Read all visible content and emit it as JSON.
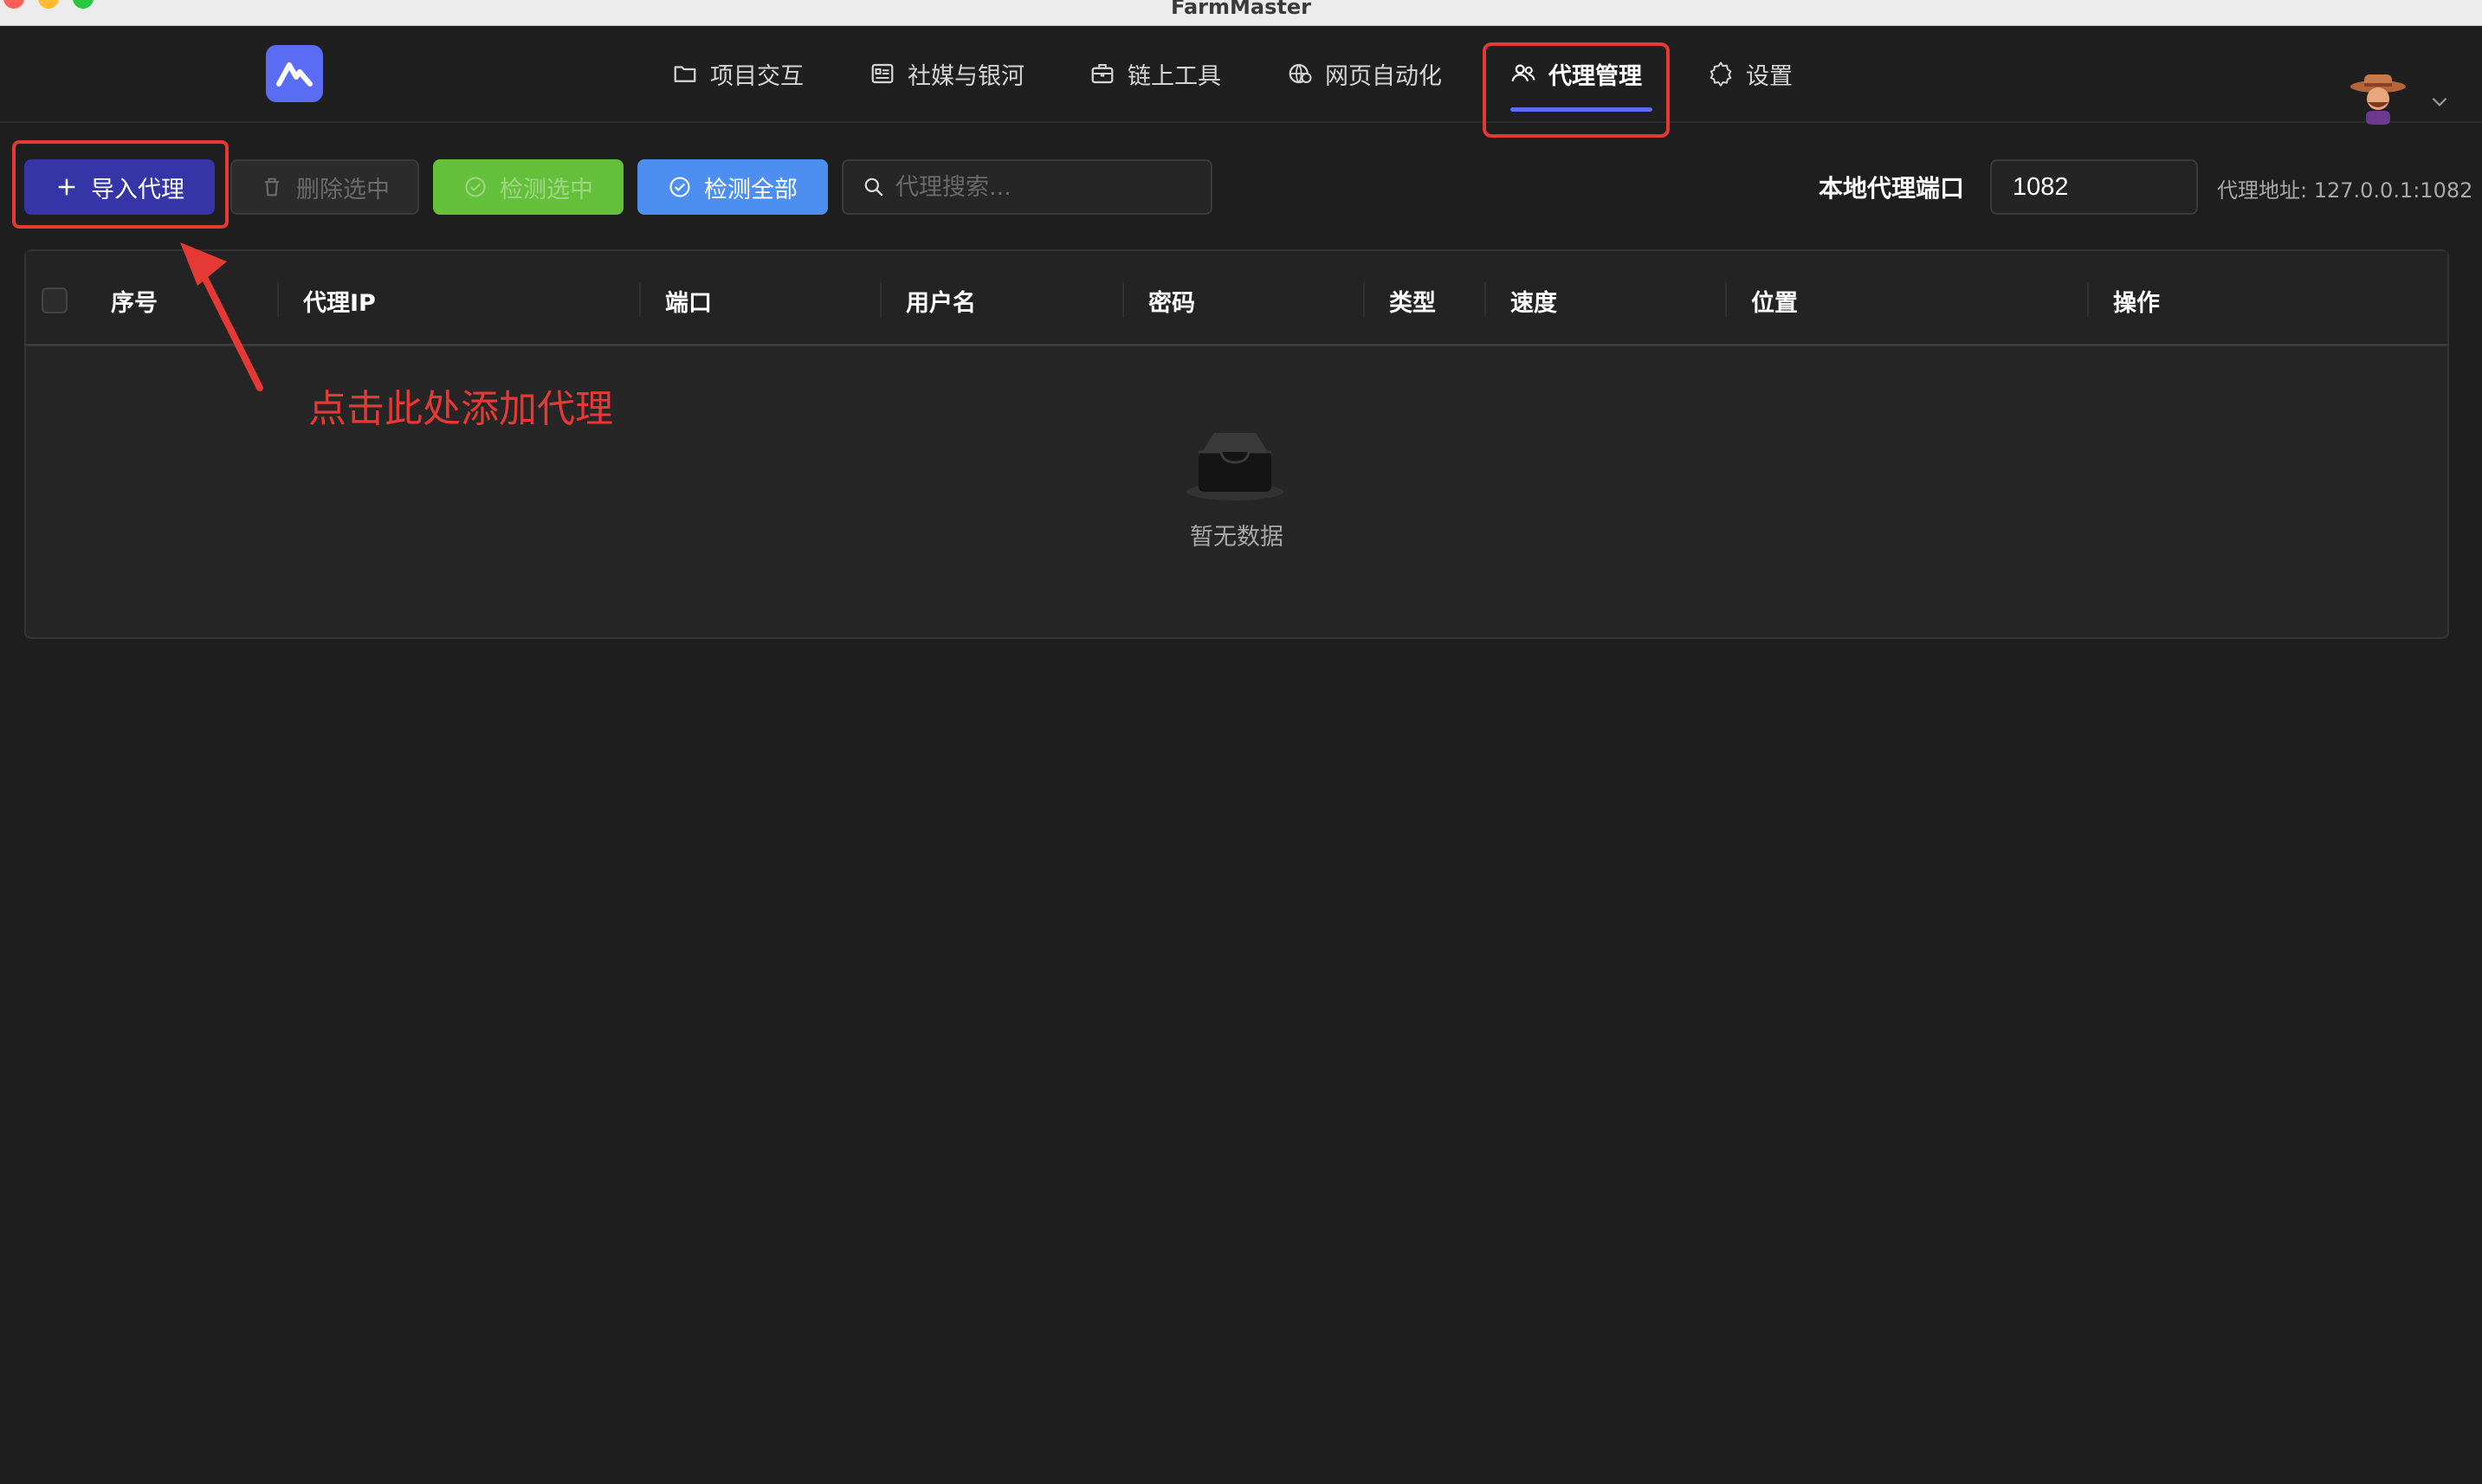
{
  "window": {
    "title": "FarmMaster"
  },
  "nav": {
    "items": [
      {
        "label": "项目交互",
        "icon": "folder-icon"
      },
      {
        "label": "社媒与银河",
        "icon": "id-card-icon"
      },
      {
        "label": "链上工具",
        "icon": "briefcase-icon"
      },
      {
        "label": "网页自动化",
        "icon": "globe-gear-icon"
      },
      {
        "label": "代理管理",
        "icon": "users-icon",
        "active": true
      },
      {
        "label": "设置",
        "icon": "gear-icon"
      }
    ]
  },
  "toolbar": {
    "import_label": "导入代理",
    "delete_label": "删除选中",
    "check_selected_label": "检测选中",
    "check_all_label": "检测全部",
    "search_placeholder": "代理搜索..."
  },
  "port": {
    "label": "本地代理端口",
    "value": "1082",
    "address_text": "代理地址: 127.0.0.1:1082"
  },
  "table": {
    "columns": [
      "序号",
      "代理IP",
      "端口",
      "用户名",
      "密码",
      "类型",
      "速度",
      "位置",
      "操作"
    ],
    "rows": [],
    "empty_text": "暂无数据"
  },
  "annotation": {
    "text": "点击此处添加代理"
  },
  "colors": {
    "accent": "#5b6cf5",
    "import_button": "#3535a8",
    "check_selected": "#64bf3a",
    "check_all": "#4c8ff0",
    "highlight_red": "#e53935"
  }
}
